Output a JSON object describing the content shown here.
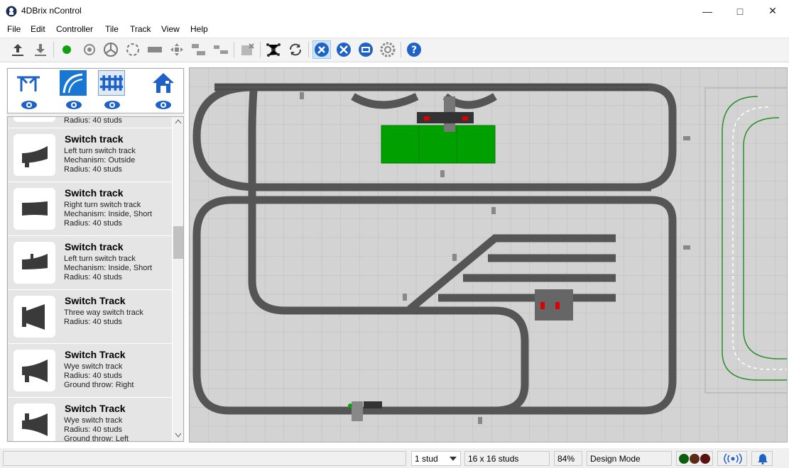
{
  "window": {
    "title": "4DBrix nControl"
  },
  "menu": [
    "File",
    "Edit",
    "Controller",
    "Tile",
    "Track",
    "View",
    "Help"
  ],
  "toolbar": {
    "icons": [
      "upload-icon",
      "download-icon",
      "green-dot-icon",
      "signal-icon",
      "turntable-icon",
      "circle-icon",
      "brick-icon",
      "cross-arrows-icon",
      "layout-icon",
      "layout2-icon",
      "delete-icon",
      "network-icon",
      "refresh-icon",
      "pencil-tools-icon",
      "tools-icon",
      "monitor-icon",
      "gear-icon",
      "help-icon"
    ]
  },
  "categories": [
    {
      "name": "structures",
      "icon": "table-icon"
    },
    {
      "name": "tracks",
      "icon": "track-curve-icon"
    },
    {
      "name": "fences",
      "icon": "fence-icon"
    },
    {
      "name": "buildings",
      "icon": "house-icon"
    }
  ],
  "list": {
    "partial_top": "Radius: 40 studs",
    "items": [
      {
        "title": "Switch track",
        "lines": [
          "Left turn switch track",
          "Mechanism: Outside",
          "Radius: 40 studs"
        ]
      },
      {
        "title": "Switch track",
        "lines": [
          "Right turn switch track",
          "Mechanism: Inside, Short",
          "Radius: 40 studs"
        ]
      },
      {
        "title": "Switch track",
        "lines": [
          "Left turn switch track",
          "Mechanism: Inside, Short",
          "Radius: 40 studs"
        ]
      },
      {
        "title": "Switch Track",
        "lines": [
          "Three way switch track",
          "Radius: 40 studs"
        ]
      },
      {
        "title": "Switch Track",
        "lines": [
          "Wye switch track",
          "Radius: 40 studs",
          "Ground throw: Right"
        ]
      },
      {
        "title": "Switch Track",
        "lines": [
          "Wye switch track",
          "Radius: 40 studs",
          "Ground throw: Left"
        ]
      }
    ]
  },
  "status": {
    "grid_select": "1 stud",
    "tile_size": "16 x 16 studs",
    "zoom": "84%",
    "mode": "Design Mode"
  },
  "colors": {
    "accent": "#1976d2",
    "track": "#5a5a5a",
    "board": "#00a000",
    "grid": "#d3d3d3"
  }
}
